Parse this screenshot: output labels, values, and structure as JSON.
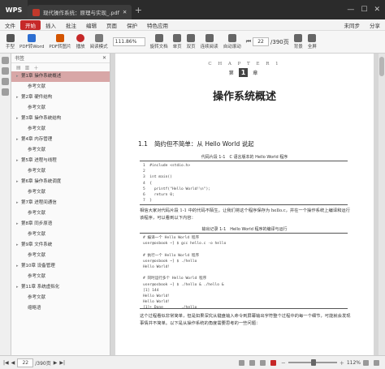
{
  "titlebar": {
    "app": "WPS",
    "tab": "现代操作系统：原理与实现_.pdf",
    "plus": "+",
    "controls": [
      "—",
      "☐",
      "✕"
    ]
  },
  "menu": [
    "文件",
    "开始",
    "插入",
    "批注",
    "编辑",
    "页面",
    "保护",
    "特色应用"
  ],
  "menu_right": [
    "未同步",
    "分享"
  ],
  "toolbar": {
    "tools": [
      {
        "label": "手型",
        "icon": "hand-icon",
        "color": "#555"
      },
      {
        "label": "PDF转Word",
        "icon": "pdf-word-icon",
        "color": "#2e6fd1"
      },
      {
        "label": "PDF转图片",
        "icon": "pdf-image-icon",
        "color": "#d35400"
      },
      {
        "label": "播放",
        "icon": "play-icon",
        "color": "#c62828"
      },
      {
        "label": "阅读模式",
        "icon": "read-mode-icon",
        "color": "#7b7b7b"
      }
    ],
    "zoom": "111.86%",
    "right_tools": [
      {
        "label": "旋转文档",
        "icon": "rotate-icon",
        "color": "#555"
      },
      {
        "label": "单页",
        "icon": "single-page-icon",
        "color": "#555"
      },
      {
        "label": "双页",
        "icon": "double-page-icon",
        "color": "#555"
      },
      {
        "label": "连续阅读",
        "icon": "continuous-icon",
        "color": "#555"
      },
      {
        "label": "自动滚动",
        "icon": "auto-scroll-icon",
        "color": "#555"
      },
      {
        "label": "背景",
        "icon": "background-icon",
        "color": "#555"
      },
      {
        "label": "全屏",
        "icon": "fullscreen-icon",
        "color": "#555"
      }
    ],
    "page_current": "22",
    "page_total": "/390页"
  },
  "bookmarks": {
    "header": "书签",
    "items": [
      {
        "label": "第1章 操作系统概述",
        "tri": true,
        "sub": false,
        "sel": true
      },
      {
        "label": "参考文献",
        "tri": false,
        "sub": true,
        "sel": false
      },
      {
        "label": "第2章 硬件结构",
        "tri": true,
        "sub": false,
        "sel": false
      },
      {
        "label": "参考文献",
        "tri": false,
        "sub": true,
        "sel": false
      },
      {
        "label": "第3章 操作系统结构",
        "tri": true,
        "sub": false,
        "sel": false
      },
      {
        "label": "参考文献",
        "tri": false,
        "sub": true,
        "sel": false
      },
      {
        "label": "第4章 内存管理",
        "tri": true,
        "sub": false,
        "sel": false
      },
      {
        "label": "参考文献",
        "tri": false,
        "sub": true,
        "sel": false
      },
      {
        "label": "第5章 进程与线程",
        "tri": true,
        "sub": false,
        "sel": false
      },
      {
        "label": "参考文献",
        "tri": false,
        "sub": true,
        "sel": false
      },
      {
        "label": "第6章 操作系统调度",
        "tri": true,
        "sub": false,
        "sel": false
      },
      {
        "label": "参考文献",
        "tri": false,
        "sub": true,
        "sel": false
      },
      {
        "label": "第7章 进程间通信",
        "tri": true,
        "sub": false,
        "sel": false
      },
      {
        "label": "参考文献",
        "tri": false,
        "sub": true,
        "sel": false
      },
      {
        "label": "第8章 同步原语",
        "tri": true,
        "sub": false,
        "sel": false
      },
      {
        "label": "参考文献",
        "tri": false,
        "sub": true,
        "sel": false
      },
      {
        "label": "第9章 文件系统",
        "tri": true,
        "sub": false,
        "sel": false
      },
      {
        "label": "参考文献",
        "tri": false,
        "sub": true,
        "sel": false
      },
      {
        "label": "第10章 设备管理",
        "tri": true,
        "sub": false,
        "sel": false
      },
      {
        "label": "参考文献",
        "tri": false,
        "sub": true,
        "sel": false
      },
      {
        "label": "第11章 系统虚拟化",
        "tri": true,
        "sub": false,
        "sel": false
      },
      {
        "label": "参考文献",
        "tri": false,
        "sub": true,
        "sel": false
      },
      {
        "label": "缩略语",
        "tri": false,
        "sub": true,
        "sel": false
      }
    ]
  },
  "document": {
    "chapter_label": "C H A P T E R 1",
    "chapter_no": "1",
    "chapter_no_suffix": "章",
    "chapter_prefix": "第",
    "chapter_title": "操作系统概述",
    "section_num": "1.1",
    "section_title": "简约但不简单：从 Hello World 说起",
    "caption1": "代码片段 1-1　C 语言版本的 Hello World 程序",
    "code1": "1  #include <stdio.h>\n2\n3  int main()\n4  {\n5    printf(\"Hello World!\\n\");\n6    return 0;\n7  }",
    "para1": "相信大家对代码片段 1-1 中的代码不陌生。让我们将这个程序保存为 hello.c，并在一个操作系统上编译和运行该程序，可以看到以下内容：",
    "caption2": "输出记录 1-1　Hello World 程序的编译与运行",
    "code2": "# 编译一个 Hello World 程序\nuser@osbook ~] $ gcc hello.c -o hello\n\n# 执行一个 Hello World 程序\nuser@osbook ~] $ ./hello\nHello World!\n\n# 同时运行多个 Hello World 程序\nuser@osbook ~] $ ./hello & ./hello &\n[1] 144\nHello World!\nHello World!\n[1]+ Done        ./hello",
    "para2": "这个过程看似非常简单，但是如果深究从键盘输入命令到屏幕输出字符整个过程中的每一个细节，可能就会发现事情并不简单。以下是从操作系统的角度需要思考的一些问题："
  },
  "statusbar": {
    "page_current": "22",
    "page_total": "/390页",
    "zoom": "112%"
  }
}
